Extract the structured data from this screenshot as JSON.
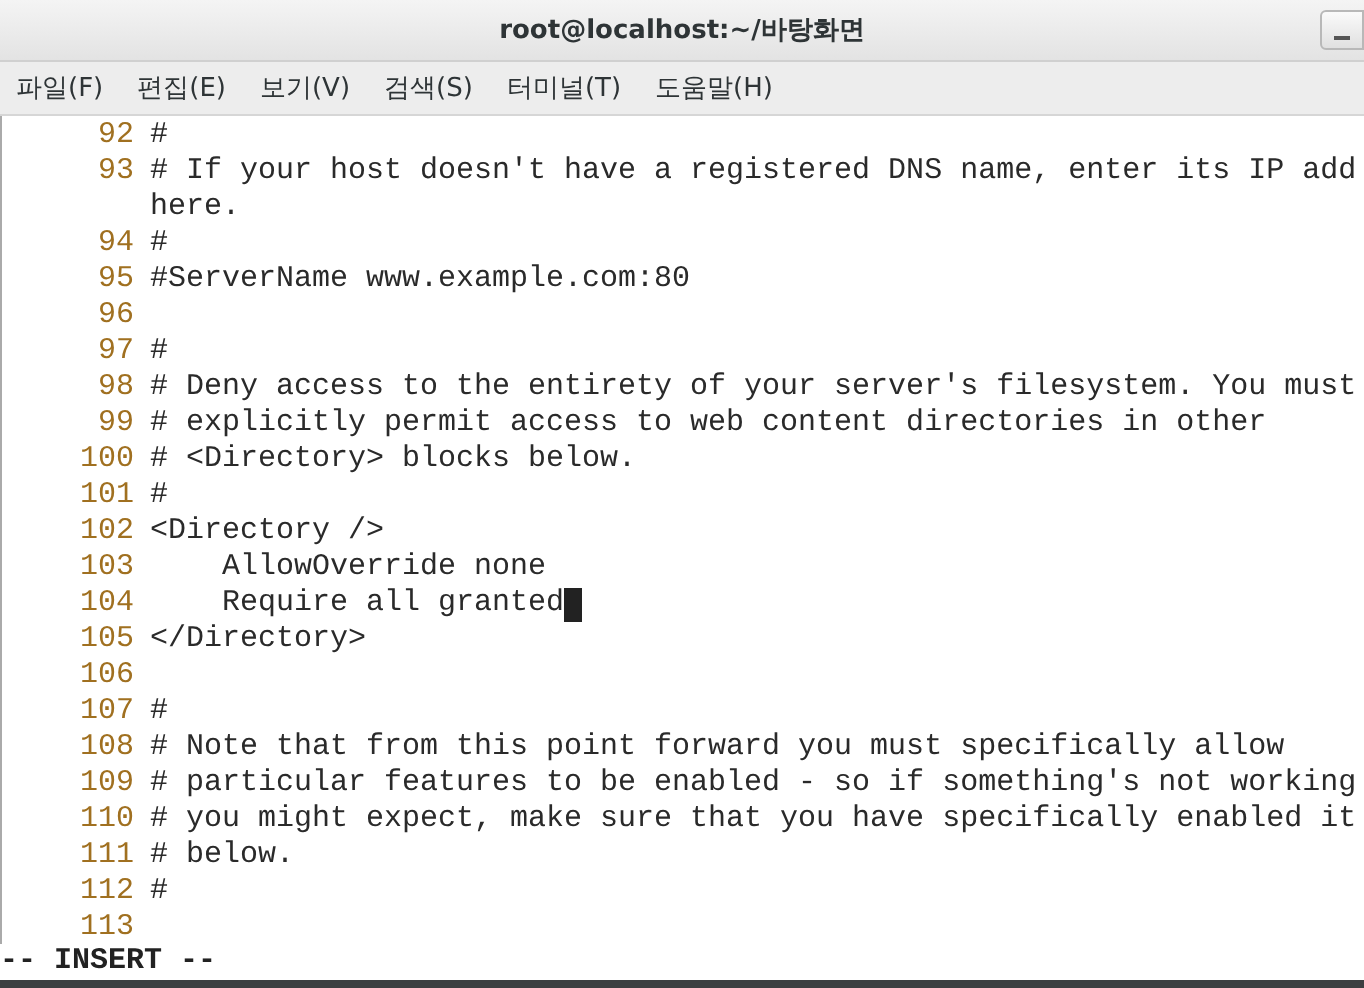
{
  "window": {
    "title": "root@localhost:~/바탕화면"
  },
  "menu": [
    "파일(F)",
    "편집(E)",
    "보기(V)",
    "검색(S)",
    "터미널(T)",
    "도움말(H)"
  ],
  "lines": [
    {
      "number": "92",
      "text": "#",
      "cursor": false
    },
    {
      "number": "93",
      "text": "# If your host doesn't have a registered DNS name, enter its IP add",
      "cursor": false
    },
    {
      "text": "here.",
      "cursor": false
    },
    {
      "number": "94",
      "text": "#",
      "cursor": false
    },
    {
      "number": "95",
      "text": "#ServerName www.example.com:80",
      "cursor": false
    },
    {
      "number": "96",
      "cursor": false
    },
    {
      "number": "97",
      "text": "#",
      "cursor": false
    },
    {
      "number": "98",
      "text": "# Deny access to the entirety of your server's filesystem. You must",
      "cursor": false
    },
    {
      "number": "99",
      "text": "# explicitly permit access to web content directories in other",
      "cursor": false
    },
    {
      "number": "100",
      "text": "# <Directory> blocks below.",
      "cursor": false
    },
    {
      "number": "101",
      "text": "#",
      "cursor": false
    },
    {
      "number": "102",
      "text": "<Directory />",
      "cursor": false
    },
    {
      "number": "103",
      "text": "    AllowOverride none",
      "cursor": false
    },
    {
      "number": "104",
      "text": "    Require all granted",
      "cursor": true
    },
    {
      "number": "105",
      "text": "</Directory>",
      "cursor": false
    },
    {
      "number": "106",
      "cursor": false
    },
    {
      "number": "107",
      "text": "#",
      "cursor": false
    },
    {
      "number": "108",
      "text": "# Note that from this point forward you must specifically allow",
      "cursor": false
    },
    {
      "number": "109",
      "text": "# particular features to be enabled - so if something's not working",
      "cursor": false
    },
    {
      "number": "110",
      "text": "# you might expect, make sure that you have specifically enabled it",
      "cursor": false
    },
    {
      "number": "111",
      "text": "# below.",
      "cursor": false
    },
    {
      "number": "112",
      "text": "#",
      "cursor": false
    },
    {
      "number": "113",
      "cursor": false
    }
  ],
  "status": "-- INSERT --"
}
